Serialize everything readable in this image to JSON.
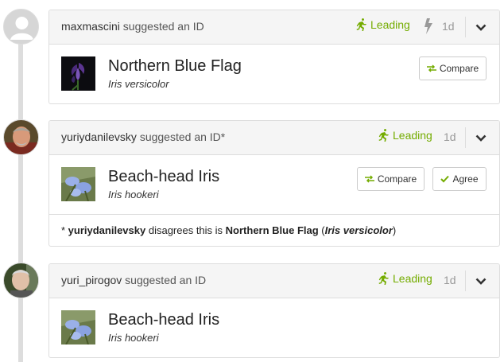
{
  "identifications": [
    {
      "user": "maxmascini",
      "action": "suggested an ID",
      "status": "Leading",
      "age": "1d",
      "taxon_common": "Northern Blue Flag",
      "taxon_scientific": "Iris versicolor",
      "compare_label": "Compare"
    },
    {
      "user": "yuriydanilevsky",
      "action": "suggested an ID*",
      "status": "Leading",
      "age": "1d",
      "taxon_common": "Beach-head Iris",
      "taxon_scientific": "Iris hookeri",
      "compare_label": "Compare",
      "agree_label": "Agree",
      "disagreement": {
        "prefix": "* ",
        "user": "yuriydanilevsky",
        "text": " disagrees this is ",
        "taxon_common": "Northern Blue Flag",
        "open_paren": " (",
        "taxon_scientific": "Iris versicolor",
        "close_paren": ")"
      }
    },
    {
      "user": "yuri_pirogov",
      "action": "suggested an ID",
      "status": "Leading",
      "age": "1d",
      "taxon_common": "Beach-head Iris",
      "taxon_scientific": "Iris hookeri"
    }
  ],
  "colors": {
    "leading_green": "#74ac00",
    "header_bg": "#f5f5f5",
    "border": "#dddddd"
  },
  "icons": [
    "default-avatar-icon",
    "leading-runner-icon",
    "bolt-icon",
    "chevron-down-icon",
    "compare-arrows-icon",
    "check-icon"
  ]
}
